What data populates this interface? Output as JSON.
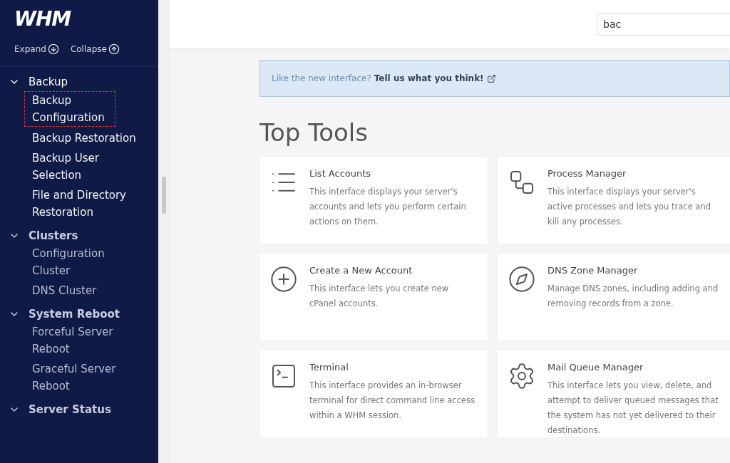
{
  "sidebar": {
    "logo": "WHM",
    "expand": "Expand",
    "collapse": "Collapse",
    "groups": [
      {
        "label": "Backup",
        "expanded": true,
        "highlighted": true,
        "items": [
          {
            "label": "Backup Configuration",
            "selected": true
          },
          {
            "label": "Backup Restoration",
            "selected": false
          },
          {
            "label": "Backup User Selection",
            "selected": false
          },
          {
            "label": "File and Directory Restoration",
            "selected": false
          }
        ]
      },
      {
        "label": "Clusters",
        "expanded": true,
        "highlighted": false,
        "items": [
          {
            "label": "Configuration Cluster",
            "selected": false
          },
          {
            "label": "DNS Cluster",
            "selected": false
          }
        ]
      },
      {
        "label": "System Reboot",
        "expanded": true,
        "highlighted": false,
        "items": [
          {
            "label": "Forceful Server Reboot",
            "selected": false
          },
          {
            "label": "Graceful Server Reboot",
            "selected": false
          }
        ]
      },
      {
        "label": "Server Status",
        "expanded": true,
        "highlighted": false
      }
    ]
  },
  "header": {
    "search": {
      "value": "bac"
    }
  },
  "banner": {
    "text": "Like the new interface?",
    "link": "Tell us what you think!"
  },
  "section_title": "Top Tools",
  "tools": [
    {
      "title": "List Accounts",
      "description": "This interface displays your server's accounts and lets you perform certain actions on them."
    },
    {
      "title": "Process Manager",
      "description": "This interface displays your server's active processes and lets you trace and kill any processes."
    },
    {
      "title": "Create a New Account",
      "description": "This interface lets you create new cPanel accounts."
    },
    {
      "title": "DNS Zone Manager",
      "description": "Manage DNS zones, including adding and removing records from a zone."
    },
    {
      "title": "Terminal",
      "description": "This interface provides an in-browser terminal for direct command line access within a WHM session."
    },
    {
      "title": "Mail Queue Manager",
      "description": "This interface lets you view, delete, and attempt to deliver queued messages that the system has not yet delivered to their destinations."
    }
  ]
}
